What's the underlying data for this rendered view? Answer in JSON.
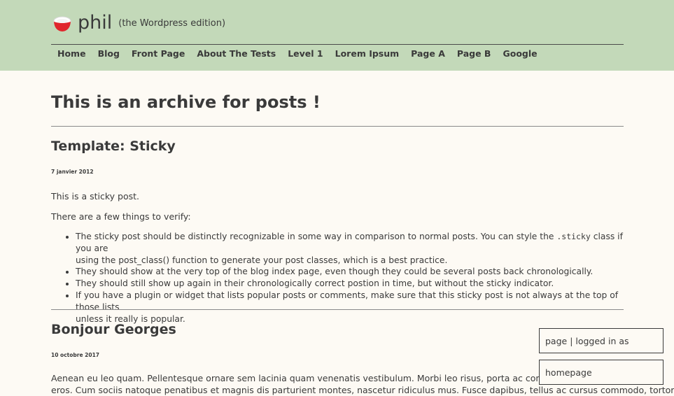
{
  "header": {
    "site_title": "phil",
    "tagline": "(the Wordpress edition)",
    "logo_icon": "red-white-bowl-icon",
    "nav_items": [
      "Home",
      "Blog",
      "Front Page",
      "About The Tests",
      "Level 1",
      "Lorem Ipsum",
      "Page A",
      "Page B",
      "Google"
    ]
  },
  "page": {
    "title": "This is an archive for posts !"
  },
  "posts": [
    {
      "title": "Template: Sticky",
      "date": "7 janvier 2012",
      "intro": "This is a sticky post.",
      "lead": "There are a few things to verify:",
      "bullets": {
        "b1_pre": "The sticky post should be distinctly recognizable in some way in comparison to normal posts. You can style the ",
        "b1_code": ".sticky",
        "b1_post": " class if you are",
        "b1_line2": "using the post_class() function to generate your post classes, which is a best practice.",
        "b2": "They should show at the very top of the blog index page, even though they could be several posts back chronologically.",
        "b3": "They should still show up again in their chronologically correct postion in time, but without the sticky indicator.",
        "b4_line1": "If you have a plugin or widget that lists popular posts or comments, make sure that this sticky post is not always at the top of those lists",
        "b4_line2": "unless it really is popular."
      }
    },
    {
      "title": "Bonjour Georges",
      "date": "10 octobre 2017",
      "excerpt_line1": "Aenean eu leo quam. Pellentesque ornare sem lacinia quam venenatis vestibulum. Morbi leo risus, porta ac consectetur a",
      "excerpt_line2": "eros. Cum sociis natoque penatibus et magnis dis parturient montes, nascetur ridiculus mus. Fusce dapibus, tellus ac cursus commodo, tortor"
    }
  ],
  "overlay": {
    "status_box": "page | logged in as gunther",
    "homepage_box": "homepage"
  }
}
